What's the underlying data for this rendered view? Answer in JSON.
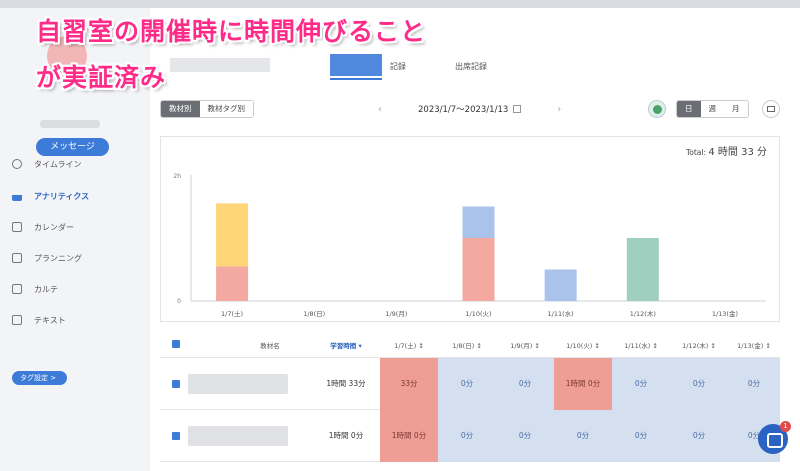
{
  "caption": {
    "line1": "自習室の開催時に時間伸びること",
    "line2": "が実証済み"
  },
  "sidebar": {
    "message_button": "メッセージ",
    "items": [
      {
        "label": "タイムライン"
      },
      {
        "label": "アナリティクス"
      },
      {
        "label": "カレンダー"
      },
      {
        "label": "プランニング"
      },
      {
        "label": "カルテ"
      },
      {
        "label": "テキスト"
      }
    ],
    "tag_button": "タグ設定 >"
  },
  "header": {
    "tabs": [
      "記録",
      "出席記録"
    ]
  },
  "toolbar": {
    "group_tabs": [
      "教材別",
      "教材タグ別"
    ],
    "prev": "‹",
    "next": "›",
    "date_range": "2023/1/7〜2023/1/13",
    "period_tabs": [
      "日",
      "週",
      "月"
    ]
  },
  "total": {
    "label": "Total:",
    "value": "4 時間 33 分"
  },
  "chart_data": {
    "type": "bar",
    "stacked": true,
    "categories": [
      "1/7(土)",
      "1/8(日)",
      "1/9(月)",
      "1/10(火)",
      "1/11(水)",
      "1/12(木)",
      "1/13(金)"
    ],
    "series": [
      {
        "color": "#f3a99f",
        "values": [
          33,
          0,
          0,
          60,
          0,
          0,
          0
        ]
      },
      {
        "color": "#ffd57a",
        "values": [
          60,
          0,
          0,
          0,
          0,
          0,
          0
        ]
      },
      {
        "color": "#a9c3ea",
        "values": [
          0,
          0,
          0,
          30,
          30,
          0,
          0
        ]
      },
      {
        "color": "#9fcfbf",
        "values": [
          0,
          0,
          0,
          0,
          0,
          60,
          0
        ]
      }
    ],
    "yticks": [
      "2h",
      "0"
    ],
    "ymax": 120,
    "grid": false
  },
  "table": {
    "headers": {
      "material": "教材名",
      "study_time": "学習時間 ▾",
      "days": [
        "1/7(土) ↕",
        "1/8(日) ↕",
        "1/9(月) ↕",
        "1/10(火) ↕",
        "1/11(水) ↕",
        "1/12(木) ↕",
        "1/13(金) ↕"
      ]
    },
    "rows": [
      {
        "total": "1時間 33分",
        "cells": [
          "33分",
          "0分",
          "0分",
          "1時間 0分",
          "0分",
          "0分",
          "0分"
        ],
        "styles": [
          "red",
          "blue",
          "blue",
          "red",
          "blue",
          "blue",
          "blue"
        ]
      },
      {
        "total": "1時間 0分",
        "cells": [
          "1時間 0分",
          "0分",
          "0分",
          "0分",
          "0分",
          "0分",
          "0分"
        ],
        "styles": [
          "red",
          "blue",
          "blue",
          "blue",
          "blue",
          "blue",
          "blue"
        ]
      }
    ]
  },
  "chat": {
    "badge": "1"
  },
  "colors": {
    "accent": "#3d7bd9",
    "caption": "#ff2b88"
  }
}
